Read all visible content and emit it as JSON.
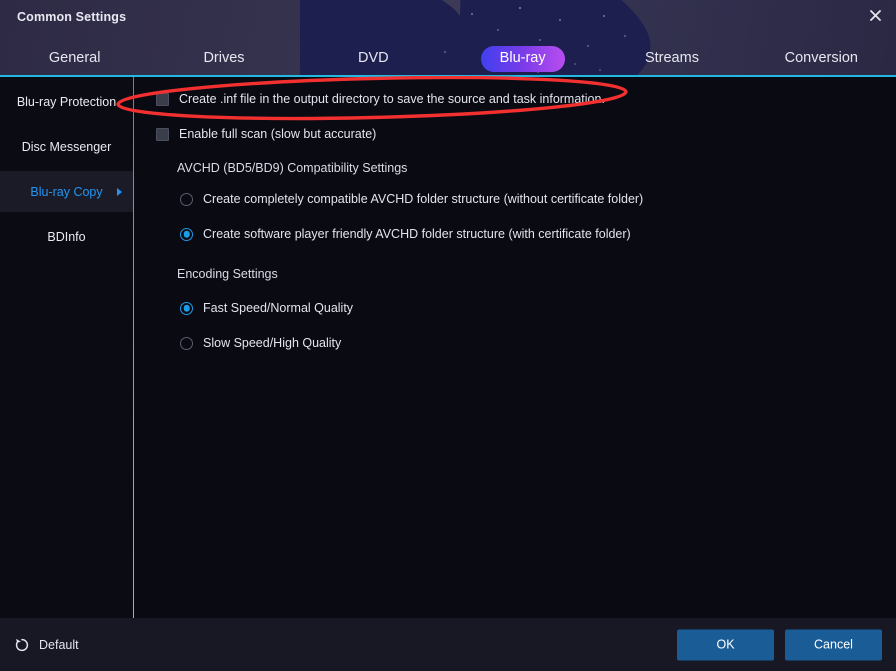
{
  "window": {
    "title": "Common Settings",
    "close_icon": "close-icon"
  },
  "tabs": [
    {
      "label": "General",
      "active": false
    },
    {
      "label": "Drives",
      "active": false
    },
    {
      "label": "DVD",
      "active": false
    },
    {
      "label": "Blu-ray",
      "active": true
    },
    {
      "label": "Streams",
      "active": false
    },
    {
      "label": "Conversion",
      "active": false
    }
  ],
  "sidebar": {
    "items": [
      {
        "label": "Blu-ray Protection",
        "active": false
      },
      {
        "label": "Disc Messenger",
        "active": false
      },
      {
        "label": "Blu-ray Copy",
        "active": true
      },
      {
        "label": "BDInfo",
        "active": false
      }
    ]
  },
  "main": {
    "checkboxes": [
      {
        "label": "Create .inf file in the output directory to save the source and task information.",
        "checked": false
      },
      {
        "label": "Enable full scan (slow but accurate)",
        "checked": false
      }
    ],
    "avchd": {
      "title": "AVCHD (BD5/BD9) Compatibility Settings",
      "options": [
        {
          "label": "Create completely compatible AVCHD folder structure (without certificate folder)",
          "selected": false
        },
        {
          "label": "Create software player friendly AVCHD folder structure (with certificate folder)",
          "selected": true
        }
      ]
    },
    "encoding": {
      "title": "Encoding Settings",
      "options": [
        {
          "label": "Fast Speed/Normal Quality",
          "selected": true
        },
        {
          "label": "Slow Speed/High Quality",
          "selected": false
        }
      ]
    }
  },
  "footer": {
    "default_label": "Default",
    "default_icon": "reset-arrow-icon",
    "ok_label": "OK",
    "cancel_label": "Cancel"
  },
  "annotation": {
    "shape": "red-ellipse-highlight",
    "color": "#f23030"
  },
  "colors": {
    "accent_blue": "#1e9ae6",
    "tab_active_gradient_start": "#4040f0",
    "tab_active_gradient_end": "#b94df0",
    "cyan_rule": "#22b8e0",
    "button_blue": "#1a5c96",
    "annotation_red": "#f23030"
  }
}
